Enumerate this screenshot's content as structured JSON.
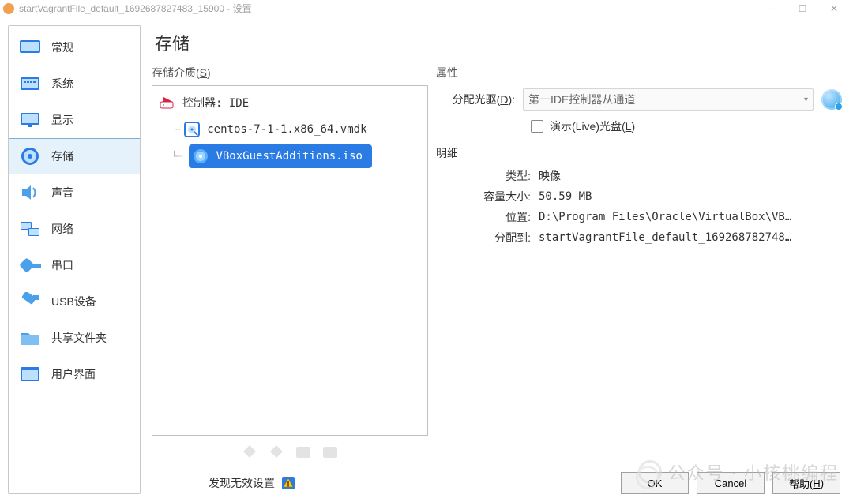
{
  "window": {
    "title": "startVagrantFile_default_1692687827483_15900 - 设置"
  },
  "sidebar": {
    "items": [
      {
        "label": "常规"
      },
      {
        "label": "系统"
      },
      {
        "label": "显示"
      },
      {
        "label": "存储"
      },
      {
        "label": "声音"
      },
      {
        "label": "网络"
      },
      {
        "label": "串口"
      },
      {
        "label": "USB设备"
      },
      {
        "label": "共享文件夹"
      },
      {
        "label": "用户界面"
      }
    ]
  },
  "page": {
    "title": "存储",
    "media_group_label": "存储介质(S)",
    "tree": {
      "controller_label": "控制器: IDE",
      "disk_label": "centos-7-1-1.x86_64.vmdk",
      "iso_label": "VBoxGuestAdditions.iso"
    },
    "attrs": {
      "section_label": "属性",
      "drive_label_pre": "分配光驱(",
      "drive_hotkey": "D",
      "drive_label_post": "):",
      "drive_value": "第一IDE控制器从通道",
      "live_cd_pre": "演示(Live)光盘(",
      "live_cd_hotkey": "L",
      "live_cd_post": ")"
    },
    "details": {
      "section_label": "明细",
      "type_label": "类型:",
      "type_value": "映像",
      "size_label": "容量大小:",
      "size_value": "50.59  MB",
      "location_label": "位置:",
      "location_value": "D:\\Program Files\\Oracle\\VirtualBox\\VB…",
      "attached_label": "分配到:",
      "attached_value": "startVagrantFile_default_169268782748…"
    }
  },
  "footer": {
    "warning_text": "发现无效设置",
    "ok": "OK",
    "cancel": "Cancel",
    "help_pre": "帮助(",
    "help_hot": "H",
    "help_post": ")"
  },
  "watermark": "公众号 · 小核桃编程"
}
